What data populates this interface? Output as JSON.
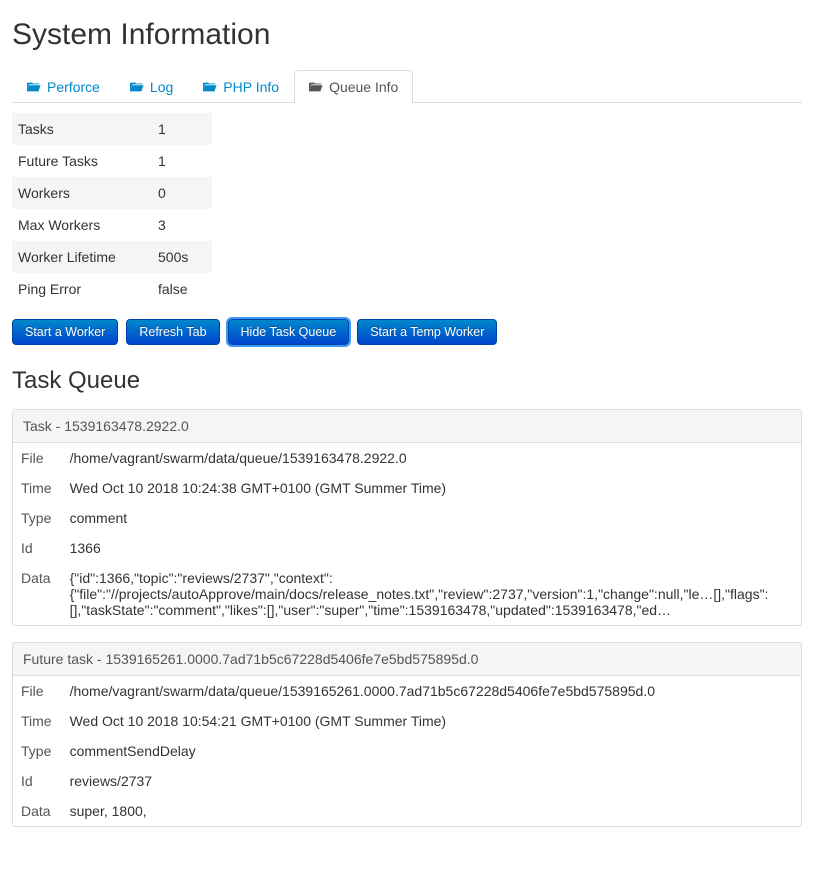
{
  "page_title": "System Information",
  "tabs": [
    {
      "label": "Perforce"
    },
    {
      "label": "Log"
    },
    {
      "label": "PHP Info"
    },
    {
      "label": "Queue Info"
    }
  ],
  "active_tab_index": 3,
  "stats": [
    {
      "label": "Tasks",
      "value": "1"
    },
    {
      "label": "Future Tasks",
      "value": "1"
    },
    {
      "label": "Workers",
      "value": "0"
    },
    {
      "label": "Max Workers",
      "value": "3"
    },
    {
      "label": "Worker Lifetime",
      "value": "500s"
    },
    {
      "label": "Ping Error",
      "value": "false"
    }
  ],
  "buttons": {
    "start_worker": "Start a Worker",
    "refresh_tab": "Refresh Tab",
    "hide_task_queue": "Hide Task Queue",
    "start_temp_worker": "Start a Temp Worker"
  },
  "task_queue": {
    "title": "Task Queue",
    "task": {
      "header": "Task - 1539163478.2922.0",
      "fields": [
        {
          "label": "File",
          "value": "/home/vagrant/swarm/data/queue/1539163478.2922.0"
        },
        {
          "label": "Time",
          "value": "Wed Oct 10 2018 10:24:38 GMT+0100 (GMT Summer Time)"
        },
        {
          "label": "Type",
          "value": "comment"
        },
        {
          "label": "Id",
          "value": "1366"
        },
        {
          "label": "Data",
          "value": "{\"id\":1366,\"topic\":\"reviews/2737\",\"context\":{\"file\":\"//projects/autoApprove/main/docs/release_notes.txt\",\"review\":2737,\"version\":1,\"change\":null,\"le…[],\"flags\":[],\"taskState\":\"comment\",\"likes\":[],\"user\":\"super\",\"time\":1539163478,\"updated\":1539163478,\"ed…"
        }
      ]
    },
    "future_task": {
      "header": "Future task - 1539165261.0000.7ad71b5c67228d5406fe7e5bd575895d.0",
      "fields": [
        {
          "label": "File",
          "value": "/home/vagrant/swarm/data/queue/1539165261.0000.7ad71b5c67228d5406fe7e5bd575895d.0"
        },
        {
          "label": "Time",
          "value": "Wed Oct 10 2018 10:54:21 GMT+0100 (GMT Summer Time)"
        },
        {
          "label": "Type",
          "value": "commentSendDelay"
        },
        {
          "label": "Id",
          "value": "reviews/2737"
        },
        {
          "label": "Data",
          "value": "super, 1800,"
        }
      ]
    }
  }
}
